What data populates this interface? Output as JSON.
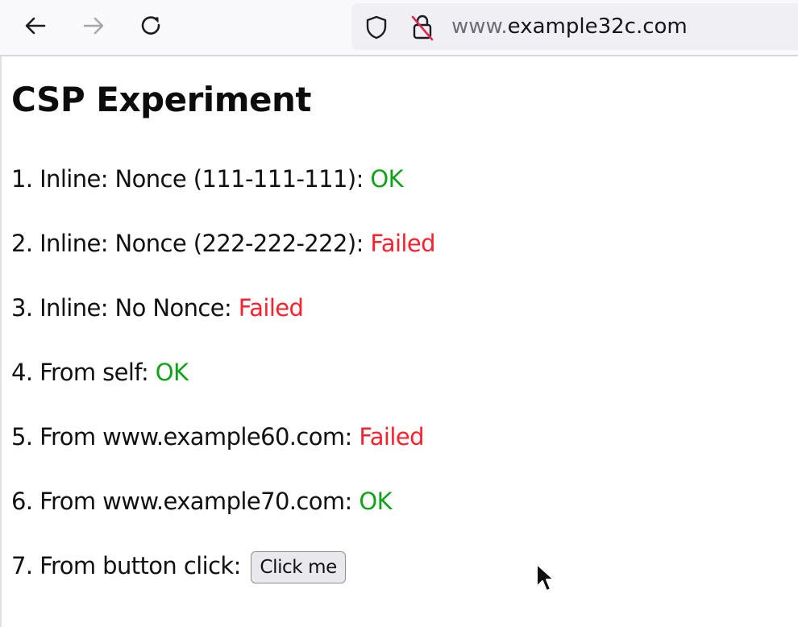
{
  "browser": {
    "url_prefix": "www.",
    "url_domain": "example32c.com"
  },
  "page": {
    "title": "CSP Experiment",
    "results": [
      {
        "label": "1. Inline: Nonce (111-111-111):",
        "status": "OK",
        "status_color": "#12a11a"
      },
      {
        "label": "2. Inline: Nonce (222-222-222):",
        "status": "Failed",
        "status_color": "#ff1f2d"
      },
      {
        "label": "3. Inline: No Nonce:",
        "status": "Failed",
        "status_color": "#ff1f2d"
      },
      {
        "label": "4. From self:",
        "status": "OK",
        "status_color": "#12a11a"
      },
      {
        "label": "5. From www.example60.com:",
        "status": "Failed",
        "status_color": "#ff1f2d"
      },
      {
        "label": "6. From www.example70.com:",
        "status": "OK",
        "status_color": "#12a11a"
      },
      {
        "label": "7. From button click:",
        "button_label": "Click me"
      }
    ]
  },
  "icons": {
    "back": "arrow-left-icon",
    "forward": "arrow-right-icon",
    "reload": "reload-icon",
    "tracking_protection": "shield-icon",
    "connection": "insecure-lock-icon",
    "pointer": "mouse-cursor-icon"
  }
}
